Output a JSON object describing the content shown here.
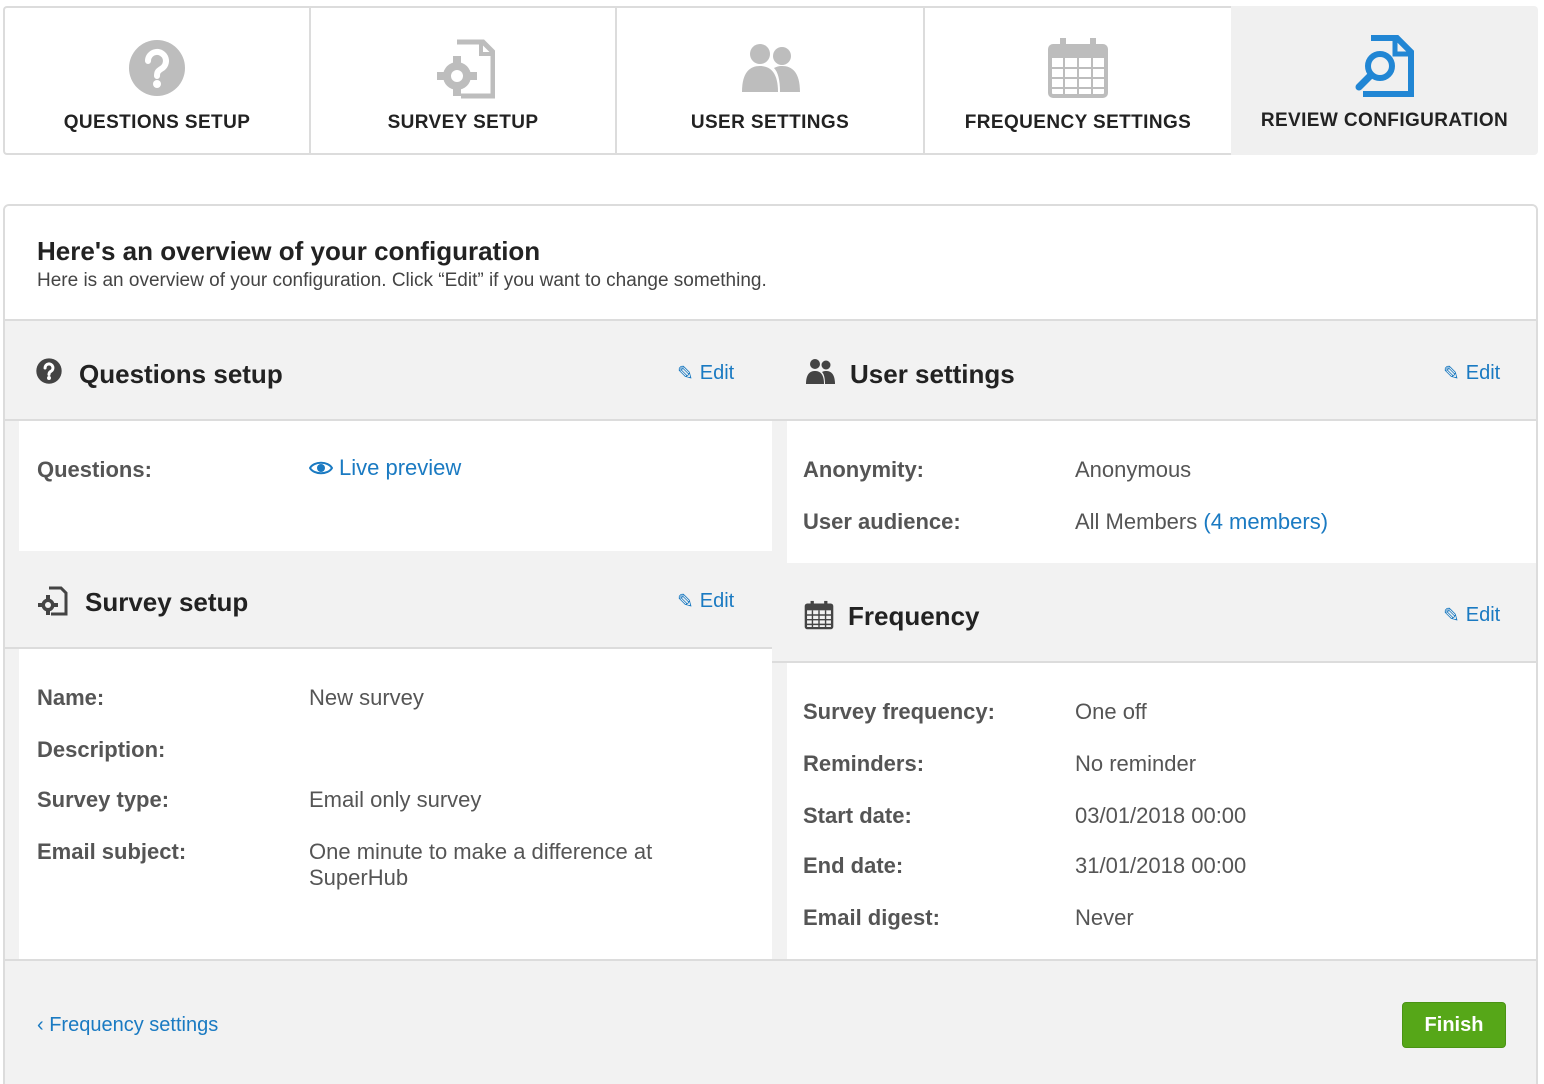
{
  "steps": [
    {
      "label": "QUESTIONS SETUP",
      "icon": "question-circle-icon"
    },
    {
      "label": "SURVEY SETUP",
      "icon": "document-gear-icon"
    },
    {
      "label": "USER SETTINGS",
      "icon": "users-icon"
    },
    {
      "label": "FREQUENCY SETTINGS",
      "icon": "calendar-icon"
    },
    {
      "label": "REVIEW CONFIGURATION",
      "icon": "document-search-icon",
      "active": true
    }
  ],
  "overview": {
    "title": "Here's an overview of your configuration",
    "subtitle": "Here is an overview of your configuration. Click “Edit” if you want to change something."
  },
  "questions_setup": {
    "title": "Questions setup",
    "edit_label": "Edit",
    "questions_label": "Questions:",
    "live_preview_label": "Live preview"
  },
  "survey_setup": {
    "title": "Survey setup",
    "edit_label": "Edit",
    "rows": [
      {
        "label": "Name:",
        "value": "New survey"
      },
      {
        "label": "Description:",
        "value": ""
      },
      {
        "label": "Survey type:",
        "value": "Email only survey"
      },
      {
        "label": "Email subject:",
        "value": "One minute to make a difference at SuperHub"
      }
    ]
  },
  "user_settings": {
    "title": "User settings",
    "edit_label": "Edit",
    "anonymity_label": "Anonymity:",
    "anonymity_value": "Anonymous",
    "audience_label": "User audience:",
    "audience_value": "All Members",
    "audience_link": "(4 members)"
  },
  "frequency": {
    "title": "Frequency",
    "edit_label": "Edit",
    "rows": [
      {
        "label": "Survey frequency:",
        "value": "One off"
      },
      {
        "label": "Reminders:",
        "value": "No reminder"
      },
      {
        "label": "Start date:",
        "value": "03/01/2018 00:00"
      },
      {
        "label": "End date:",
        "value": "31/01/2018 00:00"
      },
      {
        "label": "Email digest:",
        "value": "Never"
      }
    ]
  },
  "footer": {
    "back_label": "‹ Frequency settings",
    "finish_label": "Finish"
  },
  "colors": {
    "accent": "#1a7ac2",
    "finish_button": "#56a718",
    "icon_grey": "#bdbdbd"
  }
}
